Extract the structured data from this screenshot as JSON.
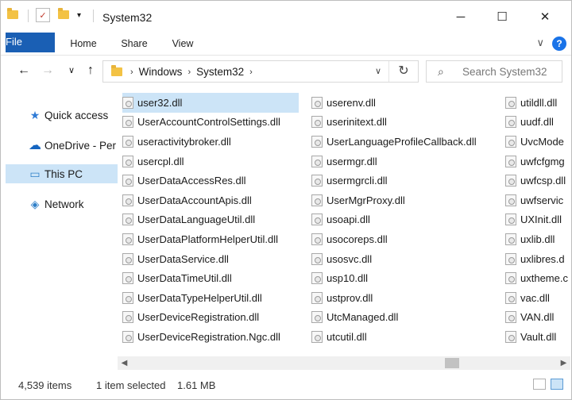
{
  "window": {
    "title": "System32"
  },
  "ribbon": {
    "tabs": [
      "File",
      "Home",
      "Share",
      "View"
    ],
    "help": "?"
  },
  "address": {
    "crumbs": [
      "Windows",
      "System32"
    ]
  },
  "search": {
    "placeholder": "Search System32"
  },
  "nav": {
    "items": [
      {
        "label": "Quick access",
        "icon": "star-icon"
      },
      {
        "label": "OneDrive - Per",
        "icon": "cloud-icon"
      },
      {
        "label": "This PC",
        "icon": "pc-icon",
        "selected": true
      },
      {
        "label": "Network",
        "icon": "network-icon"
      }
    ]
  },
  "files": {
    "columns": [
      [
        "user32.dll",
        "UserAccountControlSettings.dll",
        "useractivitybroker.dll",
        "usercpl.dll",
        "UserDataAccessRes.dll",
        "UserDataAccountApis.dll",
        "UserDataLanguageUtil.dll",
        "UserDataPlatformHelperUtil.dll",
        "UserDataService.dll",
        "UserDataTimeUtil.dll",
        "UserDataTypeHelperUtil.dll",
        "UserDeviceRegistration.dll",
        "UserDeviceRegistration.Ngc.dll"
      ],
      [
        "userenv.dll",
        "userinitext.dll",
        "UserLanguageProfileCallback.dll",
        "usermgr.dll",
        "usermgrcli.dll",
        "UserMgrProxy.dll",
        "usoapi.dll",
        "usocoreps.dll",
        "usosvc.dll",
        "usp10.dll",
        "ustprov.dll",
        "UtcManaged.dll",
        "utcutil.dll"
      ],
      [
        "utildll.dll",
        "uudf.dll",
        "UvcMode",
        "uwfcfgmg",
        "uwfcsp.dll",
        "uwfservic",
        "UXInit.dll",
        "uxlib.dll",
        "uxlibres.d",
        "uxtheme.c",
        "vac.dll",
        "VAN.dll",
        "Vault.dll"
      ]
    ],
    "selected": "user32.dll"
  },
  "status": {
    "items": "4,539 items",
    "selection": "1 item selected",
    "size": "1.61 MB"
  },
  "colors": {
    "accent": "#1a5fb4",
    "selection": "#cce4f7"
  }
}
